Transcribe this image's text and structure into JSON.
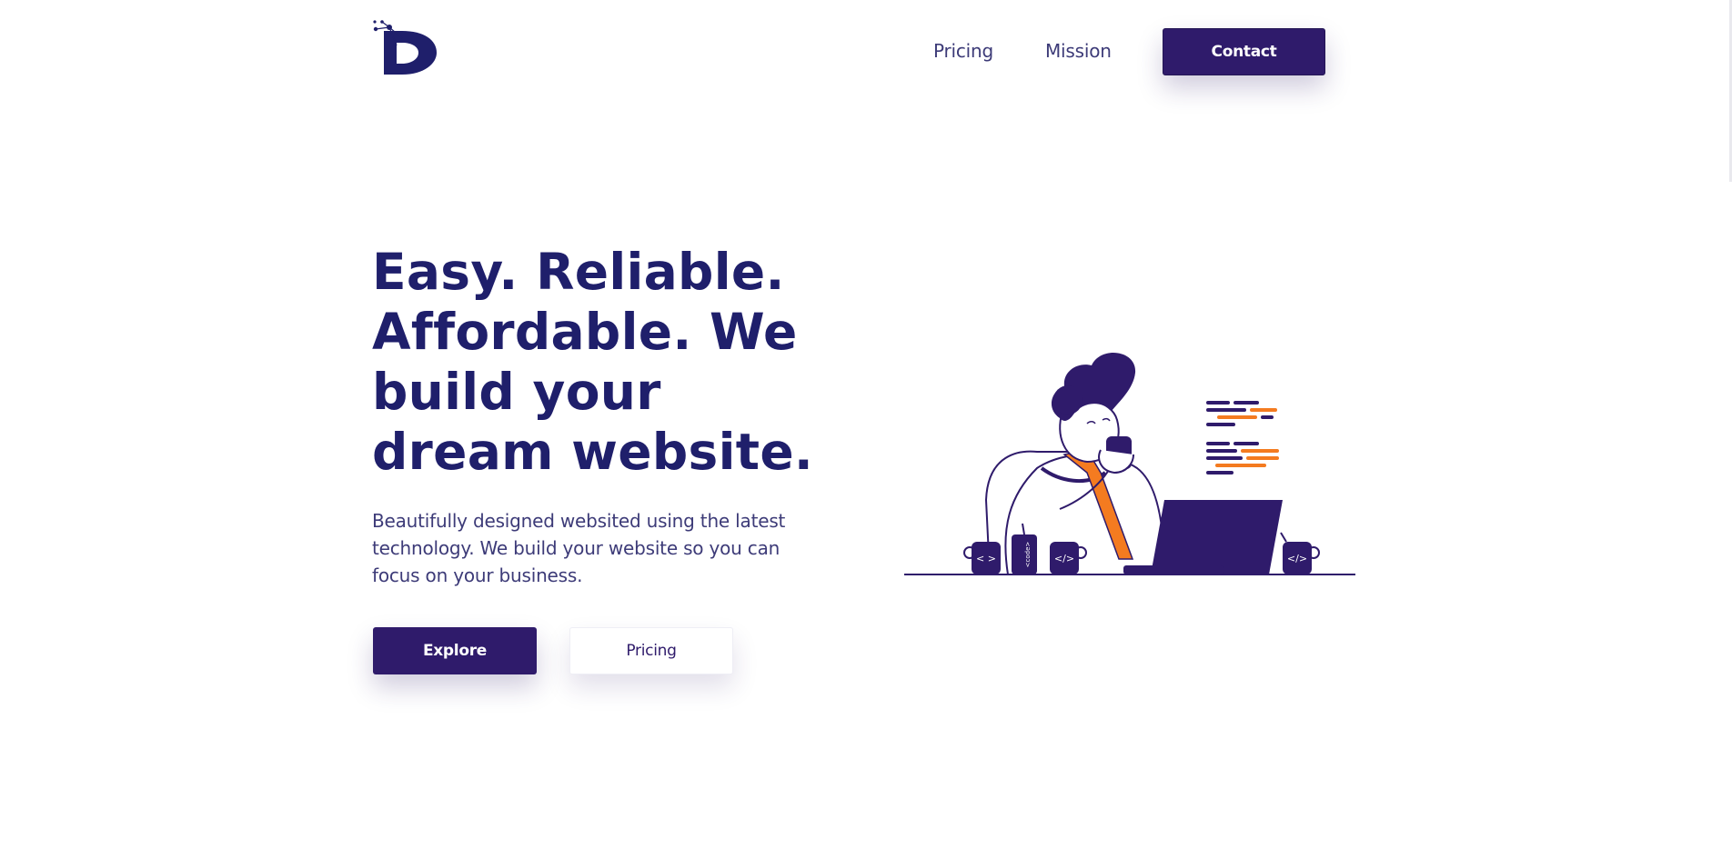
{
  "header": {
    "logo_icon": "d-logo-icon",
    "nav": {
      "pricing": "Pricing",
      "mission": "Mission"
    },
    "contact_label": "Contact"
  },
  "hero": {
    "title": "Easy. Reliable. Affordable. We build your dream website.",
    "subtitle": "Beautifully designed websited using the latest technology. We build your website so you can focus on your business.",
    "explore_label": "Explore",
    "pricing_label": "Pricing"
  },
  "illustration": {
    "name": "developer-illustration",
    "mug_left_label": "< >",
    "mug_mid_label": "</>",
    "mug_right_label": "</>",
    "can_label": "<code>"
  },
  "colors": {
    "brand": "#2f1b6b",
    "heading": "#1f1f6b",
    "text": "#3d3b78",
    "accent": "#f47b20"
  }
}
